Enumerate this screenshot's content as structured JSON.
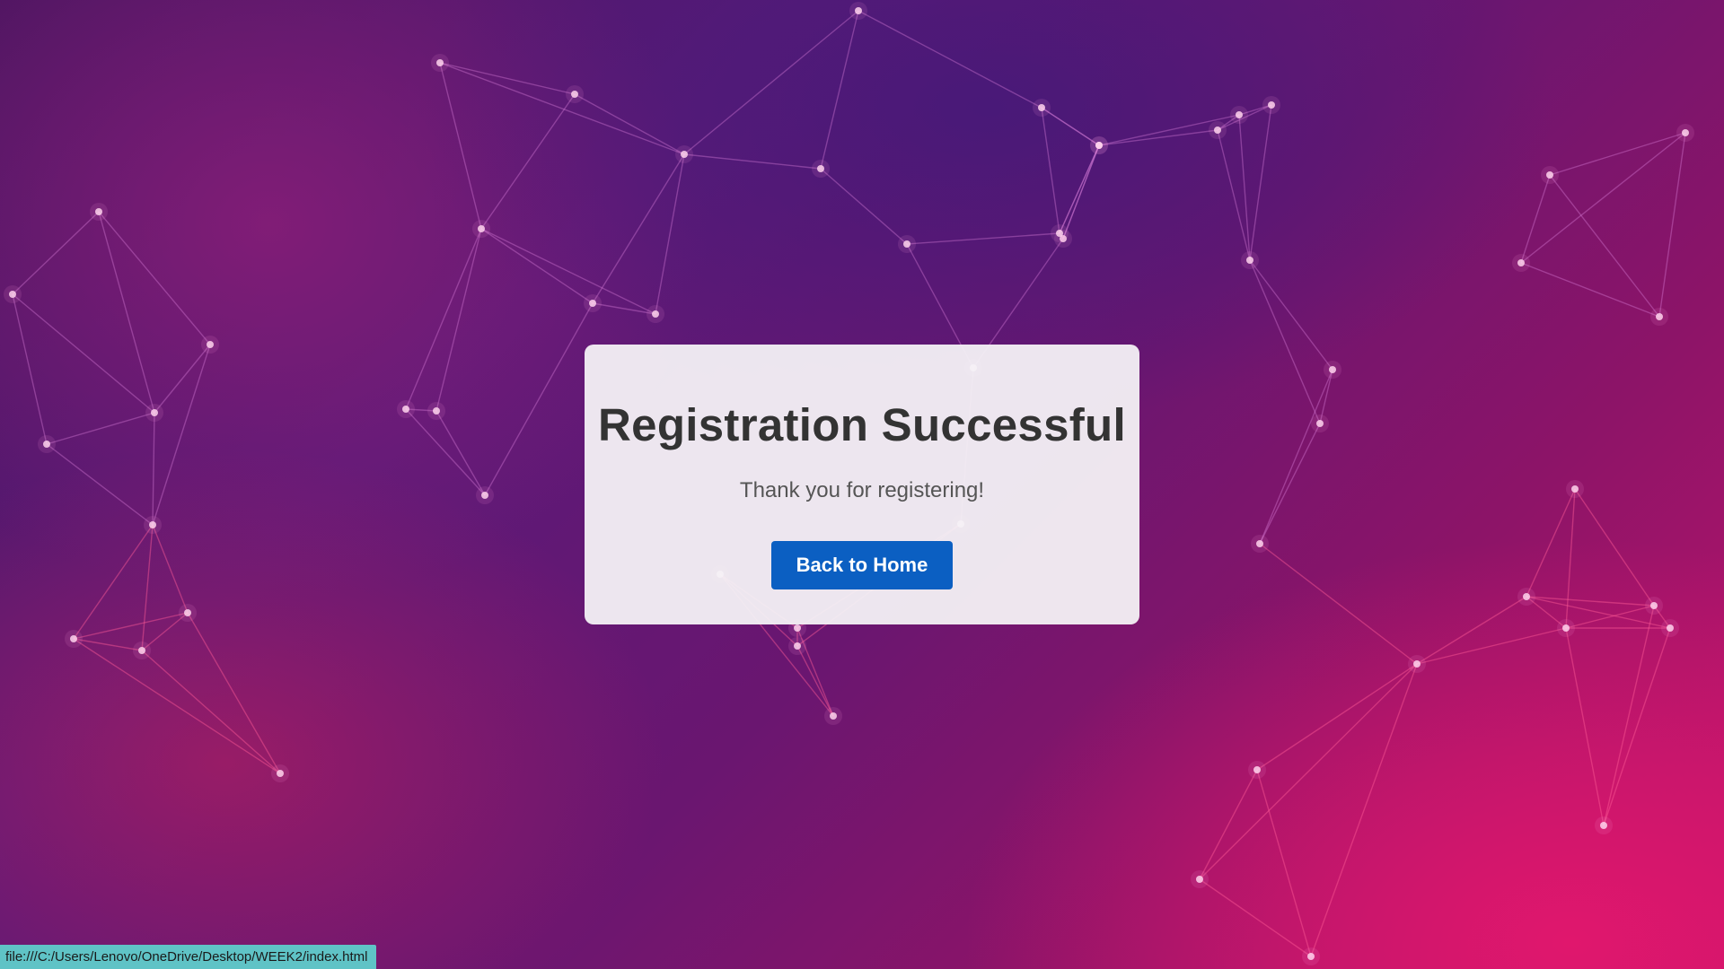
{
  "page": {
    "background_colors": [
      "#4a1560",
      "#6a1670",
      "#c2146b",
      "#e0176d"
    ]
  },
  "card": {
    "title": "Registration Successful",
    "message": "Thank you for registering!",
    "button_label": "Back to Home",
    "button_color": "#0b5fc2"
  },
  "status_bar": {
    "url": "file:///C:/Users/Lenovo/OneDrive/Desktop/WEEK2/index.html"
  }
}
